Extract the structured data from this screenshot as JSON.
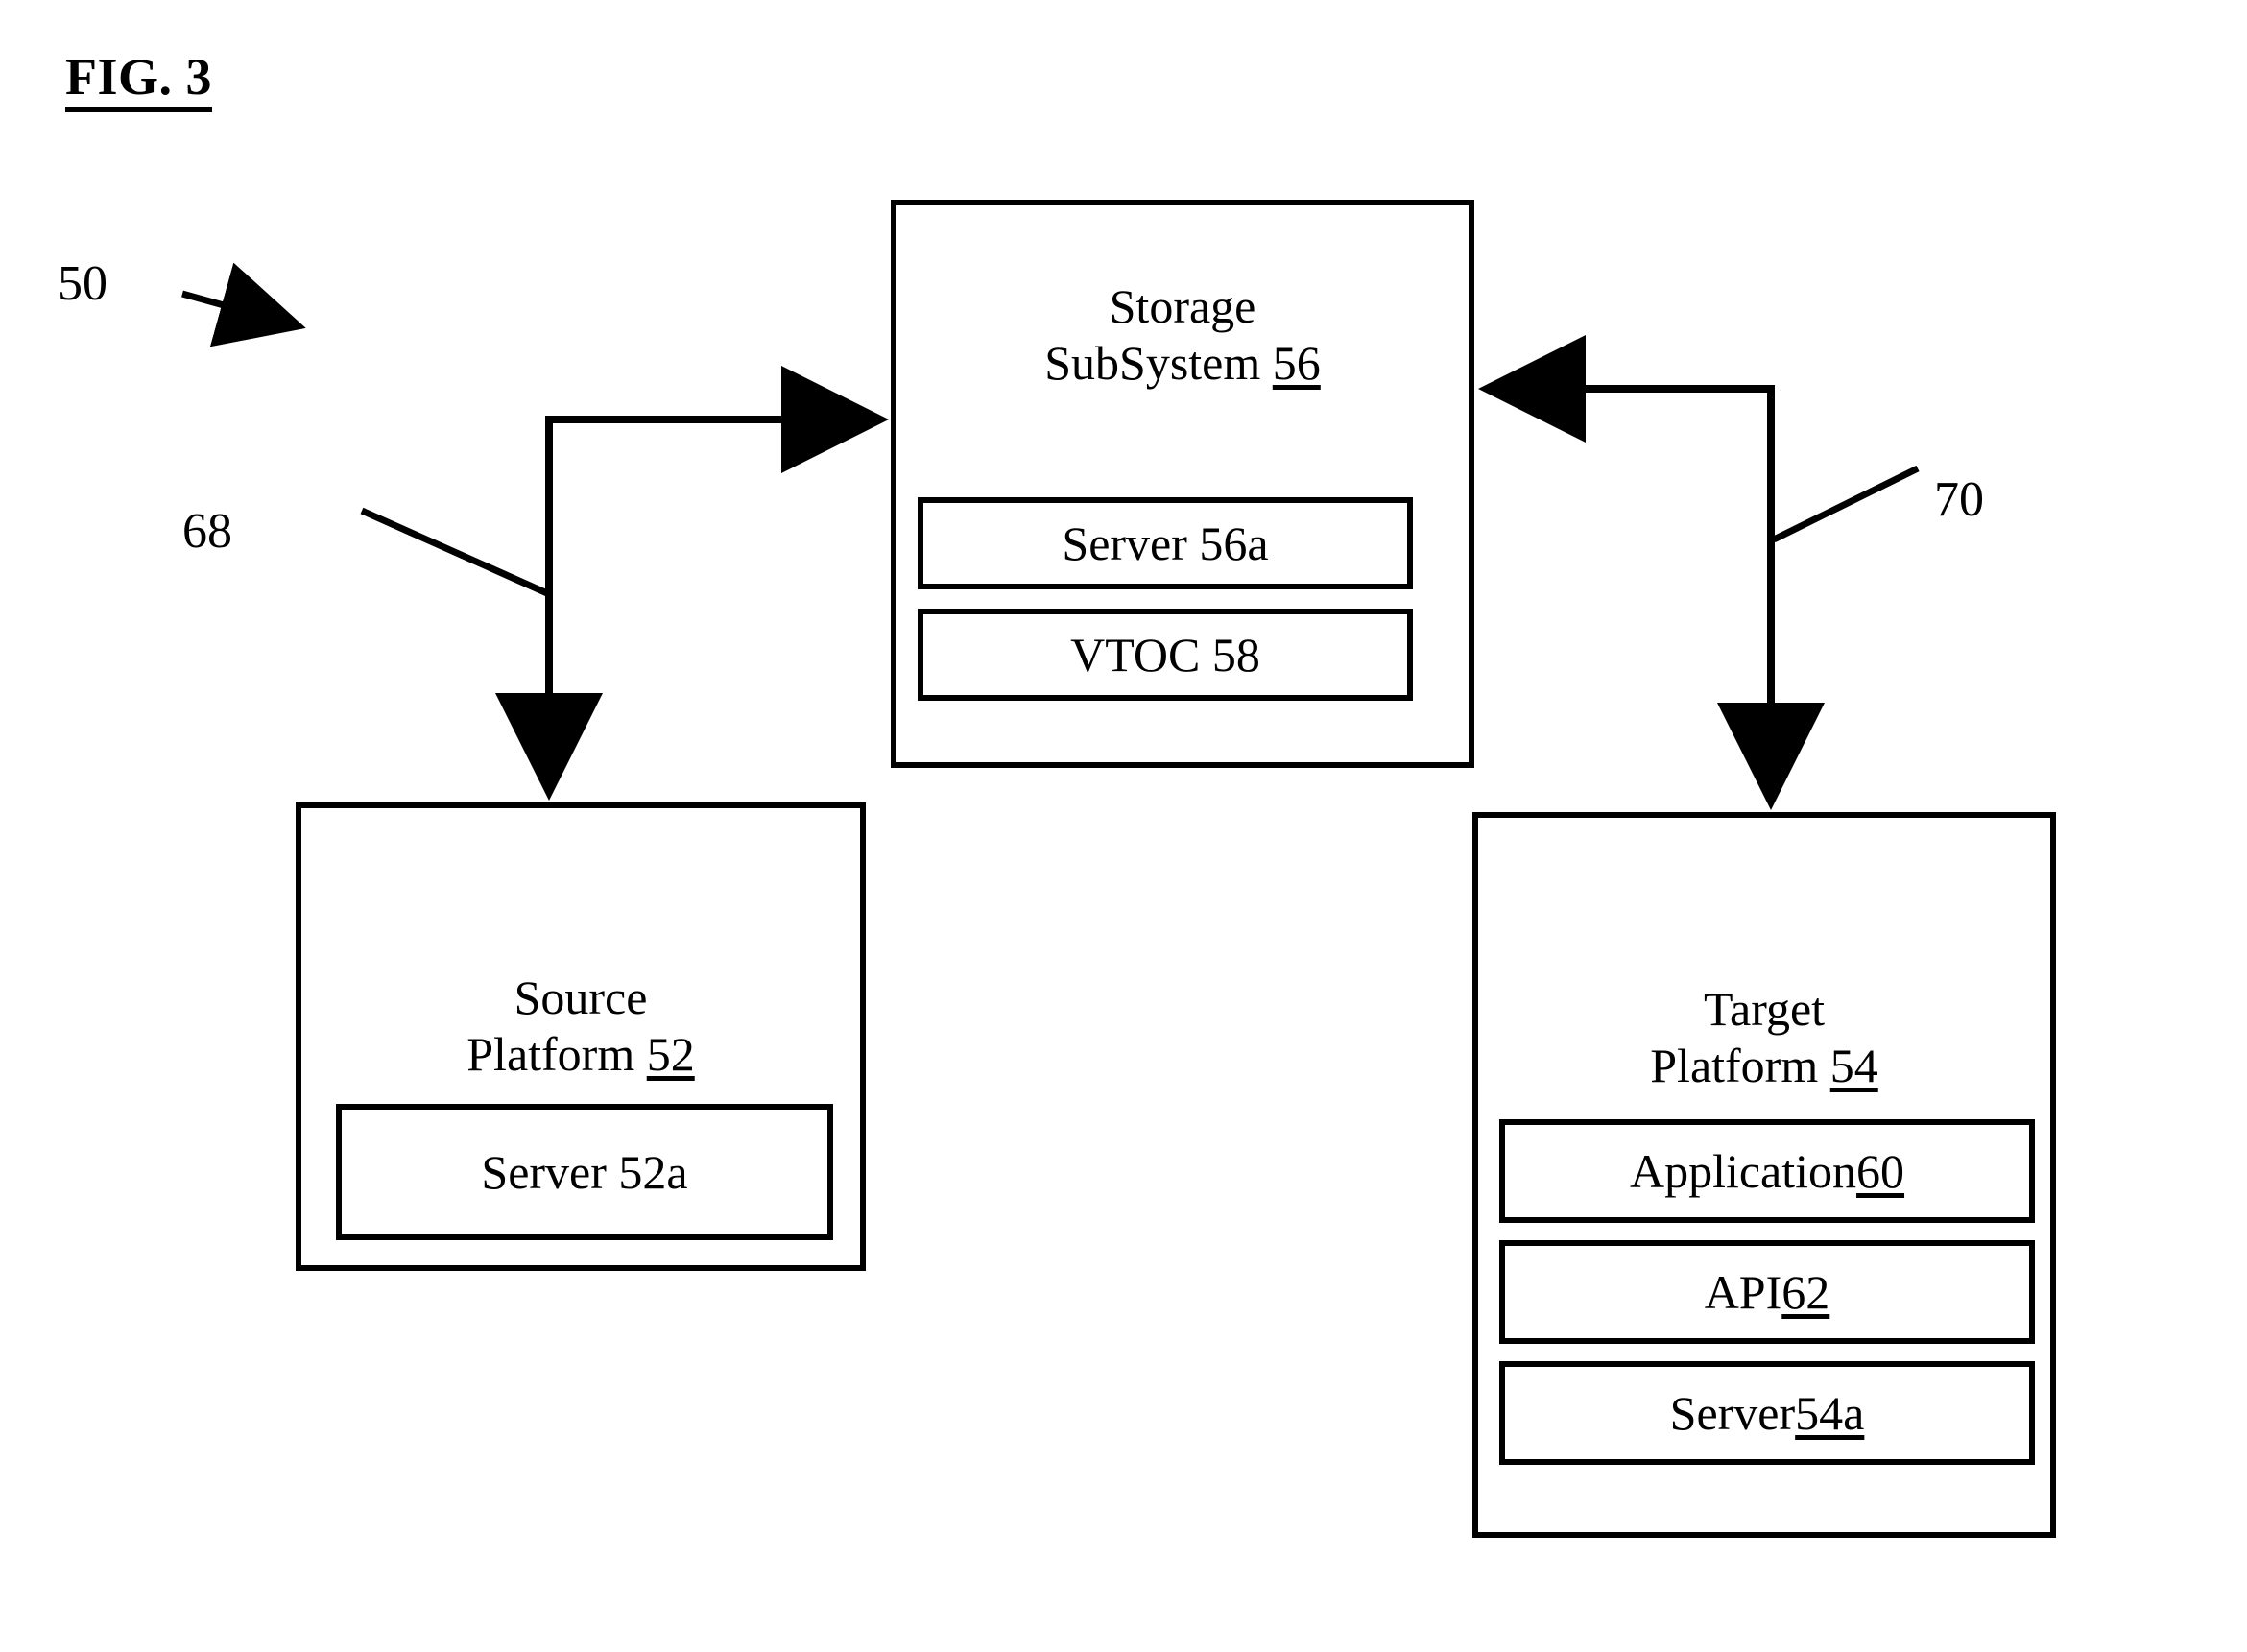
{
  "figure": {
    "title": "FIG. 3",
    "system_ref": "50"
  },
  "reference_numerals": {
    "system": "50",
    "flow_to_source": "68",
    "flow_to_target": "70"
  },
  "boxes": {
    "storage_subsystem": {
      "title_line1": "Storage",
      "title_line2": "SubSystem ",
      "ref": "56",
      "components": [
        {
          "label": "Server 56a",
          "ref": "",
          "underlined": false
        },
        {
          "label": "VTOC 58",
          "ref": "",
          "underlined": false
        }
      ]
    },
    "source_platform": {
      "title_line1": "Source",
      "title_line2": "Platform ",
      "ref": "52",
      "components": [
        {
          "label": "Server 52a",
          "ref": "",
          "underlined": false
        }
      ]
    },
    "target_platform": {
      "title_line1": "Target",
      "title_line2": "Platform ",
      "ref": "54",
      "components": [
        {
          "label": "Application ",
          "ref": "60",
          "underlined": true
        },
        {
          "label": "API ",
          "ref": "62",
          "underlined": true
        },
        {
          "label": "Server ",
          "ref": "54a",
          "underlined": true
        }
      ]
    }
  },
  "colors": {
    "ink": "#000000",
    "paper": "#ffffff"
  }
}
